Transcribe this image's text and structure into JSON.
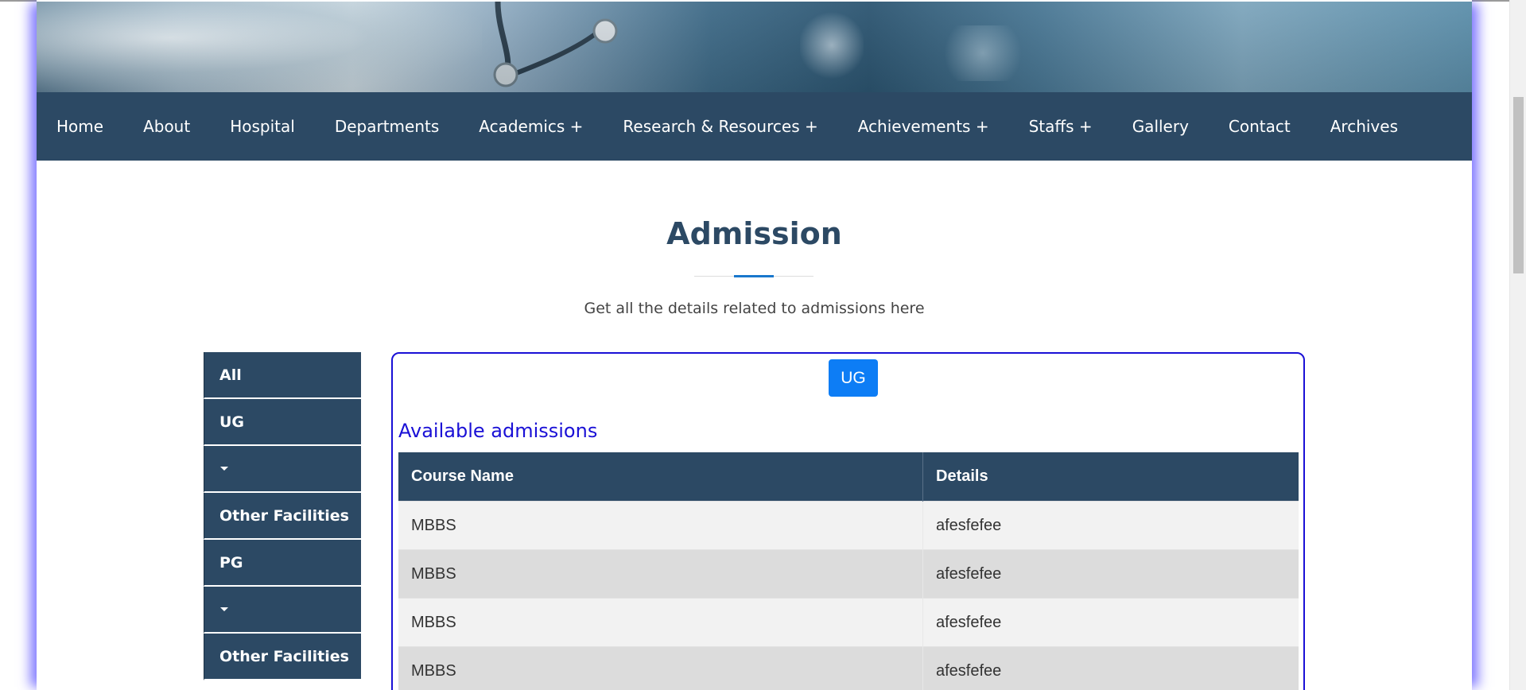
{
  "nav": {
    "items": [
      {
        "label": "Home"
      },
      {
        "label": "About"
      },
      {
        "label": "Hospital"
      },
      {
        "label": "Departments"
      },
      {
        "label": "Academics +"
      },
      {
        "label": "Research & Resources +"
      },
      {
        "label": "Achievements +"
      },
      {
        "label": "Staffs +"
      },
      {
        "label": "Gallery"
      },
      {
        "label": "Contact"
      },
      {
        "label": "Archives"
      }
    ]
  },
  "section": {
    "title": "Admission",
    "subtitle": "Get all the details related to admissions here"
  },
  "sidebar": {
    "items": [
      {
        "label": "All"
      },
      {
        "label": "UG"
      },
      {
        "label": ""
      },
      {
        "label": "Other Facilities"
      },
      {
        "label": "PG"
      },
      {
        "label": ""
      },
      {
        "label": "Other Facilities"
      }
    ]
  },
  "panel": {
    "filter_button": "UG",
    "heading": "Available admissions",
    "table": {
      "headers": [
        "Course Name",
        "Details"
      ],
      "rows": [
        [
          "MBBS",
          "afesfefee"
        ],
        [
          "MBBS",
          "afesfefee"
        ],
        [
          "MBBS",
          "afesfefee"
        ],
        [
          "MBBS",
          "afesfefee"
        ]
      ]
    }
  },
  "colors": {
    "navy": "#2c4964",
    "accent_blue": "#1977cc",
    "button_blue": "#0d7df5",
    "panel_border": "#1a10d6"
  },
  "icons": {
    "dropdown": "caret-down-icon"
  }
}
